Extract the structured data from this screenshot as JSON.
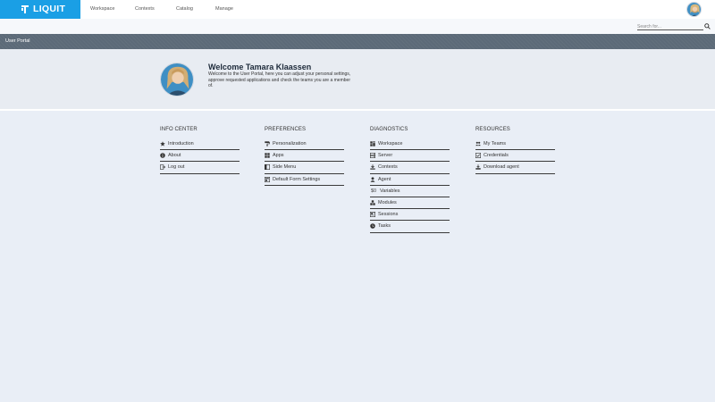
{
  "brand": {
    "name": "LIQUIT",
    "color": "#1a9fe5"
  },
  "nav": [
    {
      "label": "Workspace"
    },
    {
      "label": "Contexts"
    },
    {
      "label": "Catalog"
    },
    {
      "label": "Manage"
    }
  ],
  "search": {
    "placeholder": "Search for..."
  },
  "portal": {
    "title": "User Portal"
  },
  "welcome": {
    "title": "Welcome Tamara Klaassen",
    "text": "Welcome to the User Portal, here you can adjust your personal settings, approve requested applications and check the teams you are a member of."
  },
  "columns": [
    {
      "title": "INFO CENTER",
      "links": [
        {
          "label": "Introduction",
          "icon": "star-icon"
        },
        {
          "label": "About",
          "icon": "info-icon"
        },
        {
          "label": "Log out",
          "icon": "logout-icon"
        }
      ]
    },
    {
      "title": "PREFERENCES",
      "links": [
        {
          "label": "Personalization",
          "icon": "paint-roller-icon"
        },
        {
          "label": "Apps",
          "icon": "grid-icon"
        },
        {
          "label": "Side Menu",
          "icon": "side-menu-icon"
        },
        {
          "label": "Default Form Settings",
          "icon": "form-settings-icon"
        }
      ]
    },
    {
      "title": "DIAGNOSTICS",
      "links": [
        {
          "label": "Workspace",
          "icon": "workspace-icon"
        },
        {
          "label": "Server",
          "icon": "server-icon"
        },
        {
          "label": "Contexts",
          "icon": "contexts-icon"
        },
        {
          "label": "Agent",
          "icon": "agent-icon"
        },
        {
          "label": "Variables",
          "icon": "variables-icon",
          "glyph": "$0"
        },
        {
          "label": "Modules",
          "icon": "modules-icon"
        },
        {
          "label": "Sessions",
          "icon": "sessions-icon"
        },
        {
          "label": "Tasks",
          "icon": "tasks-icon"
        }
      ]
    },
    {
      "title": "RESOURCES",
      "links": [
        {
          "label": "My Teams",
          "icon": "teams-icon"
        },
        {
          "label": "Credentials",
          "icon": "credentials-icon"
        },
        {
          "label": "Download agent",
          "icon": "download-icon"
        }
      ]
    }
  ]
}
